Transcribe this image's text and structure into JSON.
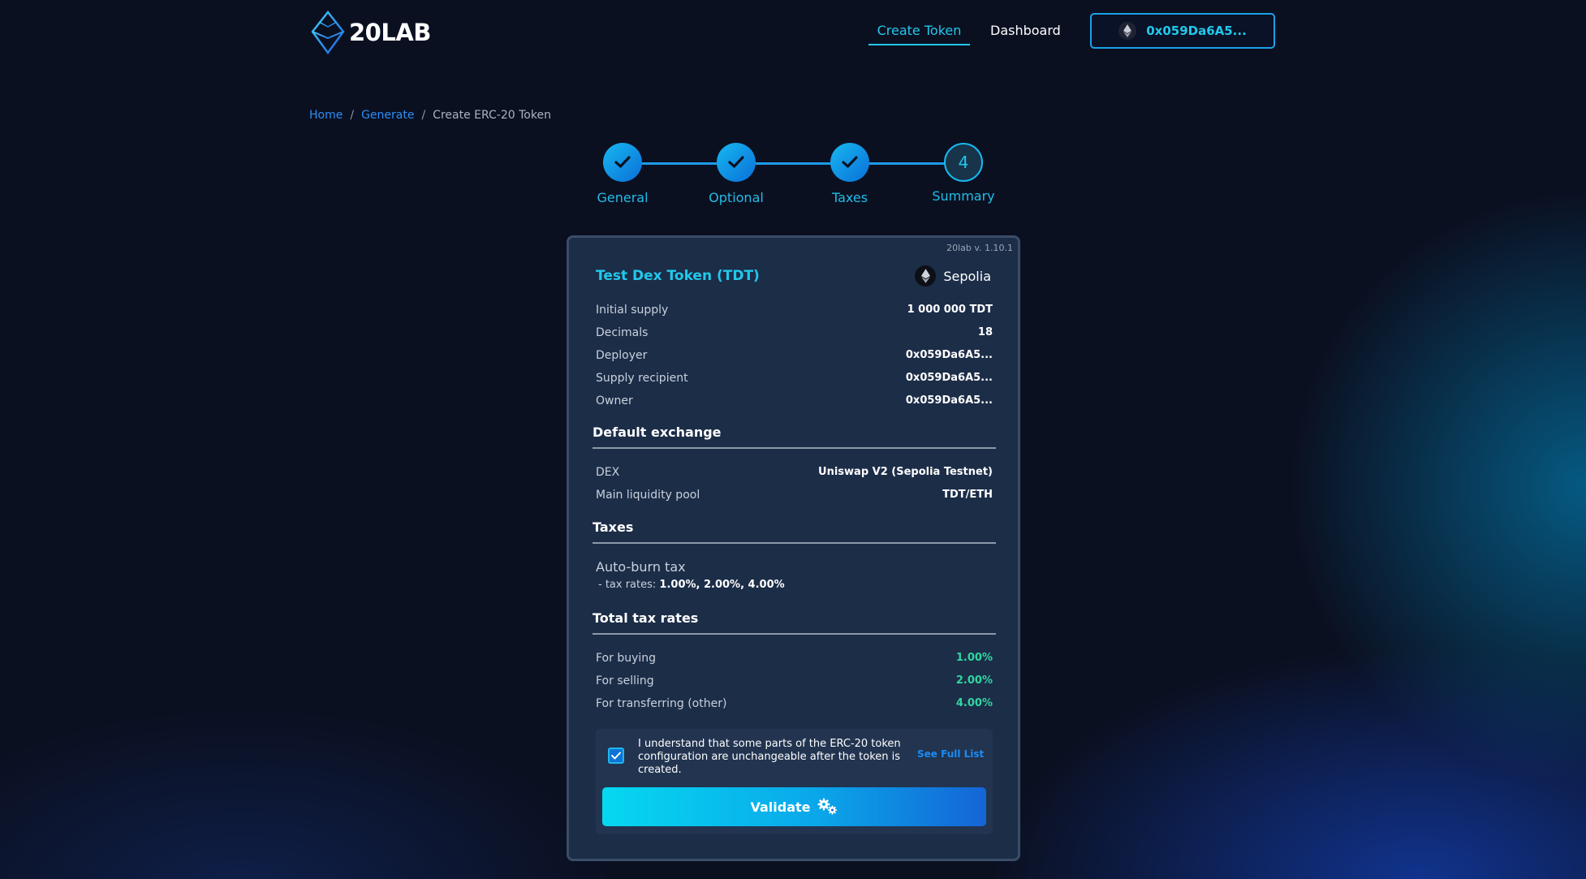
{
  "app": {
    "logo_text": "20LAB"
  },
  "nav": {
    "create_token": "Create Token",
    "dashboard": "Dashboard",
    "wallet_address": "0x059Da6A5..."
  },
  "breadcrumb": {
    "home": "Home",
    "generate": "Generate",
    "current": "Create ERC-20 Token"
  },
  "stepper": {
    "steps": [
      {
        "label": "General",
        "state": "done"
      },
      {
        "label": "Optional",
        "state": "done"
      },
      {
        "label": "Taxes",
        "state": "done"
      },
      {
        "label": "Summary",
        "state": "current",
        "number": "4"
      }
    ]
  },
  "card": {
    "version": "20lab v. 1.10.1",
    "token_title": "Test Dex Token (TDT)",
    "network": "Sepolia",
    "general_rows": [
      {
        "key": "Initial supply",
        "value": "1 000 000 TDT"
      },
      {
        "key": "Decimals",
        "value": "18"
      },
      {
        "key": "Deployer",
        "value": "0x059Da6A5..."
      },
      {
        "key": "Supply recipient",
        "value": "0x059Da6A5..."
      },
      {
        "key": "Owner",
        "value": "0x059Da6A5..."
      }
    ],
    "exchange": {
      "heading": "Default exchange",
      "rows": [
        {
          "key": "DEX",
          "value": "Uniswap V2 (Sepolia Testnet)"
        },
        {
          "key": "Main liquidity pool",
          "value": "TDT/ETH"
        }
      ]
    },
    "taxes": {
      "heading": "Taxes",
      "name": "Auto-burn tax",
      "rates_prefix": "- tax rates:",
      "rates_value": "1.00%, 2.00%, 4.00%"
    },
    "total_tax": {
      "heading": "Total tax rates",
      "rows": [
        {
          "key": "For buying",
          "value": "1.00%"
        },
        {
          "key": "For selling",
          "value": "2.00%"
        },
        {
          "key": "For transferring (other)",
          "value": "4.00%"
        }
      ]
    },
    "confirm": {
      "checked": true,
      "text": "I understand that some parts of the ERC-20 token configuration are unchangeable after the token is created.",
      "see_full_list": "See Full List"
    },
    "validate_label": "Validate"
  },
  "colors": {
    "accent": "#22c8ea",
    "link": "#2a8ff7",
    "card_bg": "#1c2d48",
    "page_bg": "#0b1021",
    "tax_value": "#2fd6a0"
  }
}
